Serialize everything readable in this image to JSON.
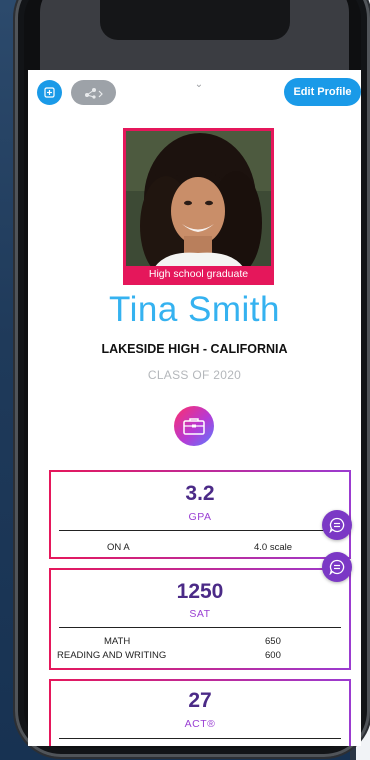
{
  "header": {
    "edit_profile_label": "Edit Profile"
  },
  "profile": {
    "photo_caption": "High school graduate",
    "name": "Tina Smith",
    "school": "LAKESIDE HIGH - CALIFORNIA",
    "class_of": "CLASS OF 2020"
  },
  "stats": {
    "gpa": {
      "value": "3.2",
      "label": "GPA",
      "rows": [
        {
          "key": "ON A",
          "value": "4.0 scale"
        }
      ]
    },
    "sat": {
      "value": "1250",
      "label": "SAT",
      "rows": [
        {
          "key": "MATH",
          "value": "650"
        },
        {
          "key": "READING AND WRITING",
          "value": "600"
        }
      ]
    },
    "act": {
      "value": "27",
      "label": "ACT®"
    }
  },
  "icons": {
    "add": "add-icon",
    "share": "share-icon",
    "briefcase": "briefcase-icon",
    "chat": "chat-icon",
    "pull_down": "chevron-down-icon"
  },
  "colors": {
    "accent_blue": "#1a9ae8",
    "name_blue": "#35b2f0",
    "accent_pink": "#e5175b",
    "accent_purple": "#7b38c5",
    "stat_value": "#4b2a87"
  }
}
